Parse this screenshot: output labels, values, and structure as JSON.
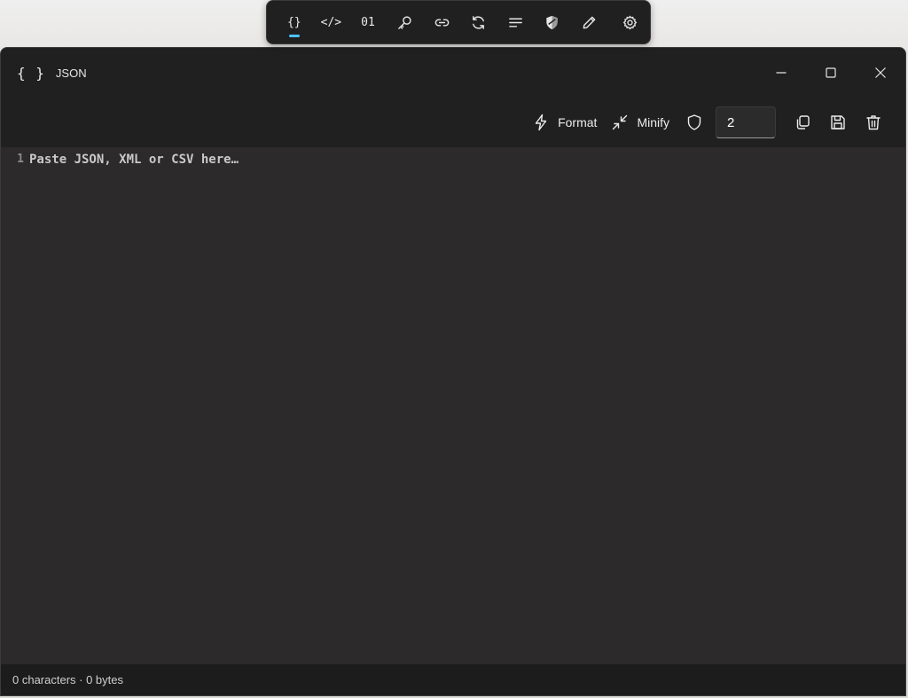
{
  "floating_toolbar": {
    "items": [
      {
        "id": "json",
        "glyph": "{}",
        "icon": "braces-icon",
        "active": true
      },
      {
        "id": "xml",
        "glyph": "</>",
        "icon": "code-icon"
      },
      {
        "id": "binary",
        "glyph": "01",
        "icon": "binary-icon"
      },
      {
        "id": "key",
        "icon": "key-icon"
      },
      {
        "id": "link",
        "icon": "link-icon"
      },
      {
        "id": "convert",
        "icon": "refresh-icon"
      },
      {
        "id": "text",
        "icon": "text-lines-icon"
      },
      {
        "id": "shield",
        "icon": "shield-icon"
      },
      {
        "id": "edit",
        "icon": "pencil-icon"
      },
      {
        "id": "settings",
        "icon": "gear-icon"
      }
    ],
    "accent": "#4cc2ff"
  },
  "window": {
    "icon_glyph": "{ }",
    "title": "JSON"
  },
  "commandbar": {
    "format_label": "Format",
    "minify_label": "Minify",
    "indent_value": "2"
  },
  "editor": {
    "line_number": "1",
    "placeholder": "Paste JSON, XML or CSV here…"
  },
  "status": {
    "text": "0 characters · 0 bytes"
  }
}
